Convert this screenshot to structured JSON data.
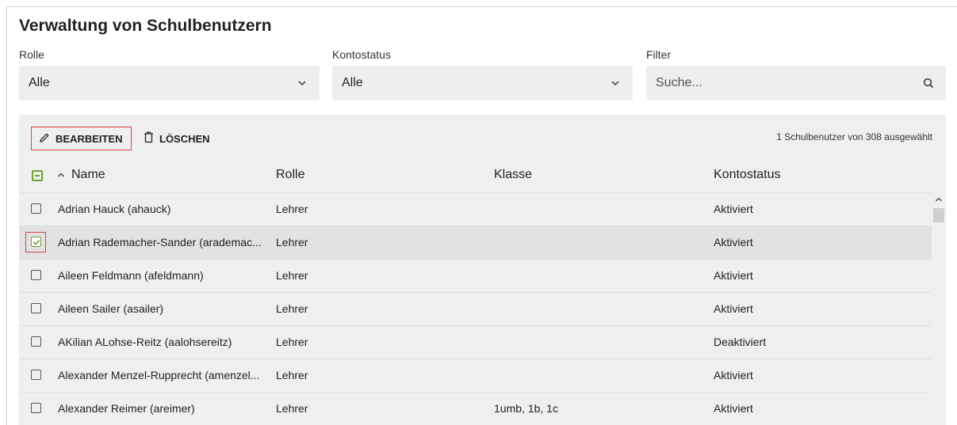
{
  "page": {
    "title": "Verwaltung von Schulbenutzern"
  },
  "filters": {
    "rolle": {
      "label": "Rolle",
      "value": "Alle"
    },
    "kontostatus": {
      "label": "Kontostatus",
      "value": "Alle"
    },
    "filter": {
      "label": "Filter",
      "placeholder": "Suche..."
    }
  },
  "toolbar": {
    "edit_label": "BEARBEITEN",
    "delete_label": "LÖSCHEN",
    "selection_count": "1 Schulbenutzer von 308 ausgewählt"
  },
  "table": {
    "columns": [
      "Name",
      "Rolle",
      "Klasse",
      "Kontostatus"
    ],
    "sort_indicator": "^",
    "rows": [
      {
        "name": "Adrian Hauck (ahauck)",
        "rolle": "Lehrer",
        "klasse": "",
        "status": "Aktiviert",
        "checked": false
      },
      {
        "name": "Adrian Rademacher-Sander (arademac...",
        "rolle": "Lehrer",
        "klasse": "",
        "status": "Aktiviert",
        "checked": true
      },
      {
        "name": "Aileen Feldmann (afeldmann)",
        "rolle": "Lehrer",
        "klasse": "",
        "status": "Aktiviert",
        "checked": false
      },
      {
        "name": "Aileen Sailer (asailer)",
        "rolle": "Lehrer",
        "klasse": "",
        "status": "Aktiviert",
        "checked": false
      },
      {
        "name": "AKilian ALohse-Reitz (aalohsereitz)",
        "rolle": "Lehrer",
        "klasse": "",
        "status": "Deaktiviert",
        "checked": false
      },
      {
        "name": "Alexander Menzel-Rupprecht (amenzel...",
        "rolle": "Lehrer",
        "klasse": "",
        "status": "Aktiviert",
        "checked": false
      },
      {
        "name": "Alexander Reimer (areimer)",
        "rolle": "Lehrer",
        "klasse": "1umb, 1b, 1c",
        "status": "Aktiviert",
        "checked": false
      }
    ]
  },
  "colors": {
    "accent_green": "#6aa22c",
    "highlight_red": "#d9434b",
    "panel_bg": "#efefef"
  }
}
